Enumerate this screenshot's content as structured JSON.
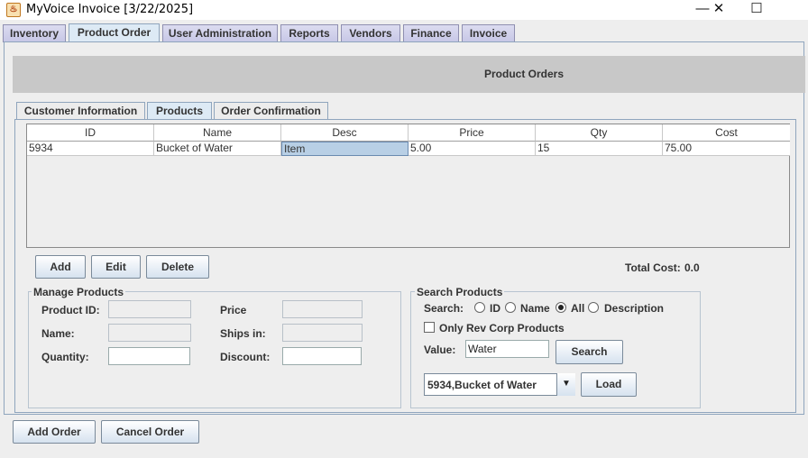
{
  "window": {
    "title": "MyVoice Invoice  [3/22/2025]",
    "minimize_glyph": "—",
    "maximize_glyph": "☐",
    "close_glyph": "✕",
    "icon": "java-cup-icon"
  },
  "main_tabs": [
    "Inventory",
    "Product Order",
    "User Administration",
    "Reports",
    "Vendors",
    "Finance",
    "Invoice"
  ],
  "active_main_tab": "Product Order",
  "header": {
    "title": "Product Orders"
  },
  "sub_tabs": [
    "Customer Information",
    "Products",
    "Order Confirmation"
  ],
  "active_sub_tab": "Products",
  "table": {
    "columns": [
      "ID",
      "Name",
      "Desc",
      "Price",
      "Qty",
      "Cost"
    ],
    "rows": [
      [
        "5934",
        "Bucket of Water",
        "Item",
        "5.00",
        "15",
        "75.00"
      ]
    ]
  },
  "actions": {
    "add": "Add",
    "edit": "Edit",
    "delete": "Delete"
  },
  "total_cost": {
    "label": "Total Cost:",
    "value": "0.0"
  },
  "manage": {
    "title": "Manage Products",
    "product_id_label": "Product ID:",
    "name_label": "Name:",
    "quantity_label": "Quantity:",
    "price_label": "Price",
    "ships_in_label": "Ships in:",
    "discount_label": "Discount:",
    "product_id_value": "",
    "name_value": "",
    "quantity_value": "",
    "price_value": "",
    "ships_in_value": "",
    "discount_value": ""
  },
  "search": {
    "title": "Search Products",
    "search_label": "Search:",
    "options": [
      "ID",
      "Name",
      "All",
      "Description"
    ],
    "selected_option": "All",
    "only_rev_corp_label": "Only Rev Corp Products",
    "only_rev_corp_checked": false,
    "value_label": "Value:",
    "value": "Water",
    "search_button": "Search",
    "result_selected": "5934,Bucket of Water",
    "load_button": "Load"
  },
  "footer": {
    "add_order": "Add Order",
    "cancel_order": "Cancel Order"
  },
  "colors": {
    "tab_active": "#ddeaf5",
    "tab_inactive": "#c6c6e6",
    "selection": "#b8cfe5",
    "header_band": "#c8c8c8"
  }
}
